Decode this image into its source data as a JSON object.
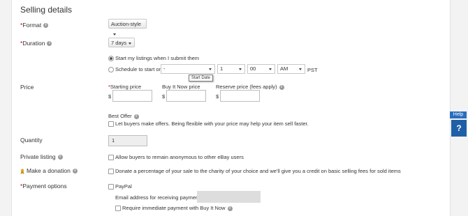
{
  "header": {
    "title": "Selling details"
  },
  "format": {
    "label": "Format",
    "value": "Auction-style"
  },
  "duration": {
    "label": "Duration",
    "value": "7 days",
    "option_immediate": "Start my listings when I submit them",
    "option_schedule": "Schedule to start on",
    "date_value": "-",
    "hour_value": "1",
    "minute_value": "00",
    "ampm_value": "AM",
    "timezone": "PST",
    "tooltip": "Start Date"
  },
  "price": {
    "label": "Price",
    "starting_label": "Starting price",
    "buy_now_label": "Buy It Now price",
    "reserve_label": "Reserve price",
    "reserve_note": "(fees apply)",
    "currency": "$"
  },
  "best_offer": {
    "label": "Best Offer",
    "checkbox_text": "Let buyers make offers. Being flexible with your price may help your item sell faster."
  },
  "quantity": {
    "label": "Quantity",
    "value": "1"
  },
  "private_listing": {
    "label": "Private listing",
    "checkbox_text": "Allow buyers to remain anonymous to other eBay users"
  },
  "donation": {
    "label": "Make a donation",
    "checkbox_text": "Donate a percentage of your sale to the charity of your choice and we'll give you a credit on basic selling fees for sold items"
  },
  "payment": {
    "label": "Payment options",
    "paypal_label": "PayPal",
    "email_label": "Email address for receiving payment:",
    "immediate_label": "Require immediate payment with Buy It Now"
  },
  "help": {
    "tab_label": "Help",
    "icon_text": "?"
  },
  "colors": {
    "required": "#cc0000",
    "help_blue": "#2a6ebd"
  }
}
